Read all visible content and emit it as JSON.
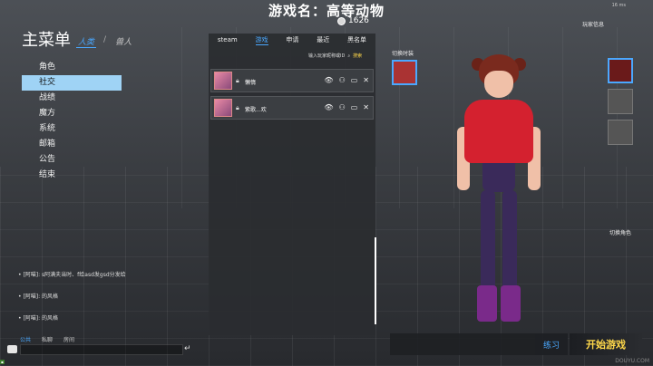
{
  "header": {
    "title": "游戏名：高等动物",
    "coins": "1626",
    "ping": "16 ms",
    "player_info": "玩家信息"
  },
  "menu": {
    "title": "主菜单",
    "tabs": [
      "人类",
      "兽人"
    ],
    "items": [
      "角色",
      "社交",
      "战绩",
      "魔方",
      "系统",
      "邮箱",
      "公告",
      "结束"
    ],
    "active_index": 1
  },
  "social": {
    "tabs": [
      "steam",
      "游戏",
      "申请",
      "最近",
      "黑名单"
    ],
    "active_tab": 1,
    "search_placeholder": "输入玩家昵称或ID",
    "search_button": "搜索",
    "friends": [
      {
        "name": "懒惰"
      },
      {
        "name": "紫歌...欢"
      }
    ]
  },
  "chat": {
    "messages": [
      "• [阿喵]: s阿满夫当时、f给asd发gsd分发给",
      "• [阿喵]: 的风格",
      "• [阿喵]: 的风格"
    ],
    "tabs": [
      "公共",
      "私聊",
      "房间"
    ],
    "active_tab": 0
  },
  "right": {
    "costume_label": "切换时装",
    "switch_char_label": "切换角色",
    "practice": "练习",
    "start": "开始游戏",
    "watermark": "DOUYU.COM"
  },
  "colors": {
    "accent": "#4aa8ff",
    "gold": "#ffd84a",
    "menu_active_bg": "#9fd3f5"
  }
}
